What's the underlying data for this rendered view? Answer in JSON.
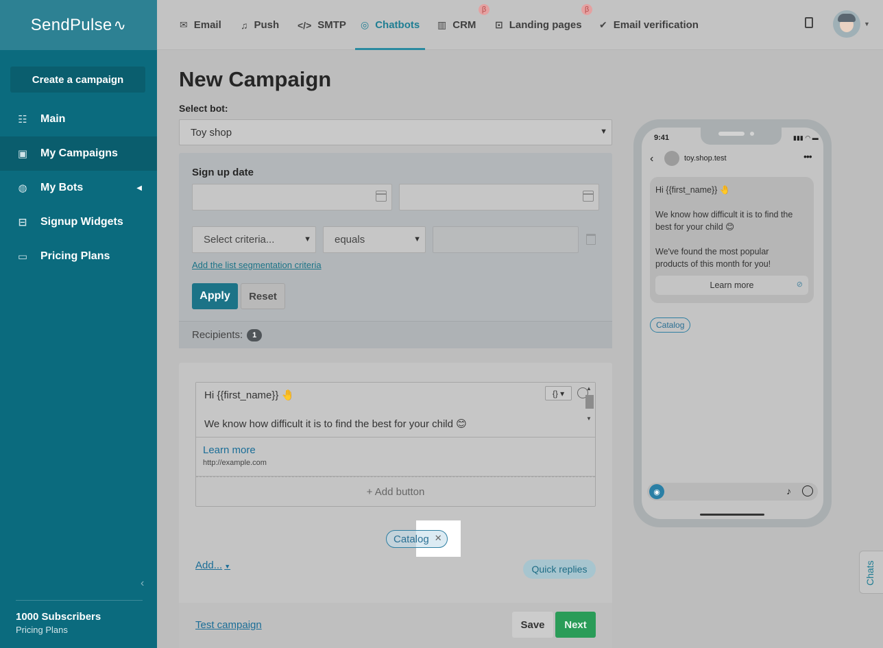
{
  "app": {
    "logo": "SendPulse"
  },
  "sidebar": {
    "create_label": "Create a campaign",
    "items": [
      {
        "label": "Main",
        "icon": "sliders-icon"
      },
      {
        "label": "My Campaigns",
        "icon": "inbox-icon",
        "active": true
      },
      {
        "label": "My Bots",
        "icon": "globe-icon"
      },
      {
        "label": "Signup Widgets",
        "icon": "download-box-icon"
      },
      {
        "label": "Pricing Plans",
        "icon": "wallet-icon"
      }
    ],
    "subscribers": "1000 Subscribers",
    "plan_link": "Pricing Plans"
  },
  "topnav": {
    "tabs": [
      {
        "label": "Email",
        "icon": "envelope-icon"
      },
      {
        "label": "Push",
        "icon": "bell-icon"
      },
      {
        "label": "SMTP",
        "icon": "code-icon"
      },
      {
        "label": "Chatbots",
        "icon": "chat-icon",
        "active": true
      },
      {
        "label": "CRM",
        "icon": "kanban-icon",
        "beta": "β"
      },
      {
        "label": "Landing pages",
        "icon": "cursor-page-icon",
        "beta": "β"
      },
      {
        "label": "Email verification",
        "icon": "check-circle-icon"
      }
    ]
  },
  "page": {
    "title": "New Campaign",
    "select_bot_label": "Select bot:",
    "bot_value": "Toy shop"
  },
  "filters": {
    "signup_label": "Sign up date",
    "criteria_placeholder": "Select criteria...",
    "operator": "equals",
    "add_criteria": "Add the list segmentation criteria",
    "apply": "Apply",
    "reset": "Reset",
    "recipients_label": "Recipients:",
    "recipients_count": "1"
  },
  "editor": {
    "line1": "Hi {{first_name}} 🤚",
    "line2": "We know how difficult it is to find the best for your child 😊",
    "var_button": "{} ▾",
    "button_title": "Learn more",
    "button_url": "http://example.com",
    "add_button": "+ Add button",
    "quick_reply": "Catalog",
    "add_menu": "Add...",
    "quick_replies_tag": "Quick replies",
    "test_campaign": "Test campaign",
    "save": "Save",
    "next": "Next"
  },
  "preview": {
    "time": "9:41",
    "status": "▮▮▮ ◠ ▬",
    "contact": "toy.shop.test",
    "msg_line1": "Hi {{first_name}} 🤚",
    "msg_line2": "We know how difficult it is to find the",
    "msg_line3": "best for your child 😊",
    "msg_line4": "We've found the most popular",
    "msg_line5": "products of this month for you!",
    "button": "Learn more",
    "quick_reply": "Catalog"
  },
  "chats_tab": "Chats",
  "colors": {
    "sidebar": "#0b6b7e",
    "accent": "#1f7e93",
    "next": "#2a9c58"
  }
}
